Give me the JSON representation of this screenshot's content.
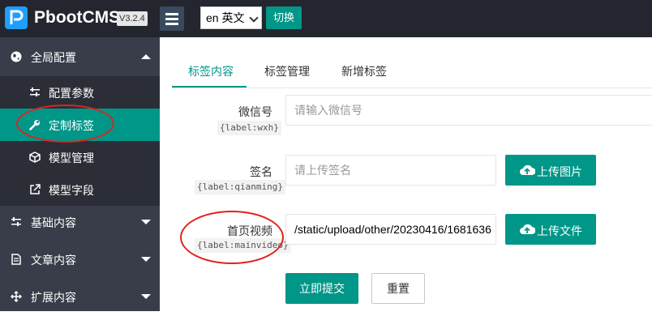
{
  "header": {
    "logo_text": "PbootCMS",
    "version": "V3.2.4",
    "language_select_value": "en 英文",
    "switch_button": "切换"
  },
  "sidebar": {
    "groups": [
      {
        "label": "全局配置",
        "icon": "globe-icon",
        "expanded": true,
        "items": [
          {
            "label": "配置参数",
            "icon": "sliders-icon",
            "active": false
          },
          {
            "label": "定制标签",
            "icon": "wrench-icon",
            "active": true
          },
          {
            "label": "模型管理",
            "icon": "cube-icon",
            "active": false
          },
          {
            "label": "模型字段",
            "icon": "external-link-icon",
            "active": false
          }
        ]
      },
      {
        "label": "基础内容",
        "icon": "sliders-icon",
        "expanded": false
      },
      {
        "label": "文章内容",
        "icon": "document-icon",
        "expanded": false
      },
      {
        "label": "扩展内容",
        "icon": "expand-arrows-icon",
        "expanded": false
      }
    ]
  },
  "tabs": [
    {
      "label": "标签内容",
      "active": true
    },
    {
      "label": "标签管理",
      "active": false
    },
    {
      "label": "新增标签",
      "active": false
    }
  ],
  "form": {
    "fields": [
      {
        "label": "微信号",
        "tag": "{label:wxh}",
        "placeholder": "请输入微信号",
        "value": ""
      },
      {
        "label": "签名",
        "tag": "{label:qianming}",
        "placeholder": "请上传签名",
        "value": "",
        "upload_button": "上传图片"
      },
      {
        "label": "首页视频",
        "tag": "{label:mainvideo}",
        "placeholder": "",
        "value": "/static/upload/other/20230416/1681636",
        "upload_button": "上传文件"
      }
    ],
    "submit_button": "立即提交",
    "reset_button": "重置"
  },
  "colors": {
    "accent": "#009688",
    "topbar": "#23262e",
    "sidebar": "#393d49",
    "annotation": "#e0231d"
  }
}
